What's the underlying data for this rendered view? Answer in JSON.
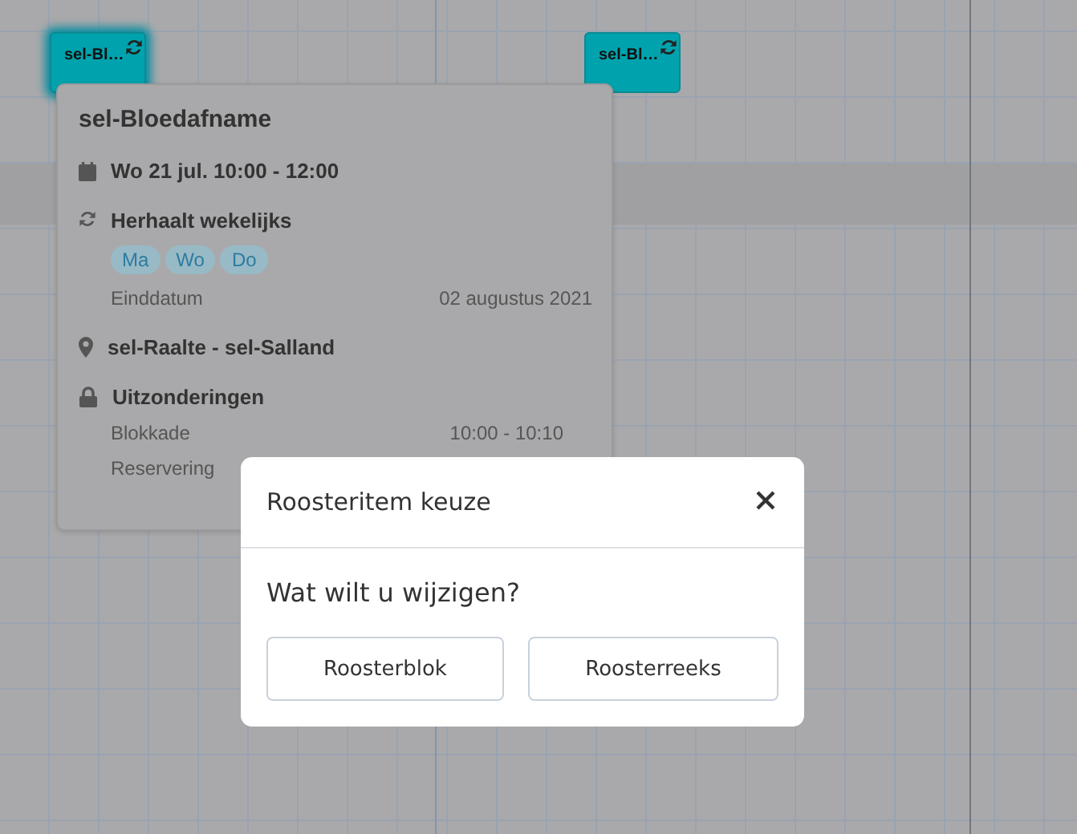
{
  "calendar": {
    "events": [
      {
        "label": "sel-Bl…",
        "repeating": true,
        "selected": true
      },
      {
        "label": "sel-Bl…",
        "repeating": true,
        "selected": false
      }
    ]
  },
  "popover": {
    "title": "sel-Bloedafname",
    "date": "Wo 21 jul. 10:00 - 12:00",
    "recurrence": {
      "label": "Herhaalt wekelijks",
      "days": [
        "Ma",
        "Wo",
        "Do"
      ],
      "end_label": "Einddatum",
      "end_value": "02 augustus 2021"
    },
    "location": "sel-Raalte - sel-Salland",
    "exceptions": {
      "label": "Uitzonderingen",
      "rows": [
        {
          "label": "Blokkade",
          "value": "10:00 - 10:10"
        },
        {
          "label": "Reservering"
        }
      ]
    }
  },
  "dialog": {
    "title": "Roosteritem keuze",
    "question": "Wat wilt u wijzigen?",
    "buttons": [
      "Roosterblok",
      "Roosterreeks"
    ]
  }
}
